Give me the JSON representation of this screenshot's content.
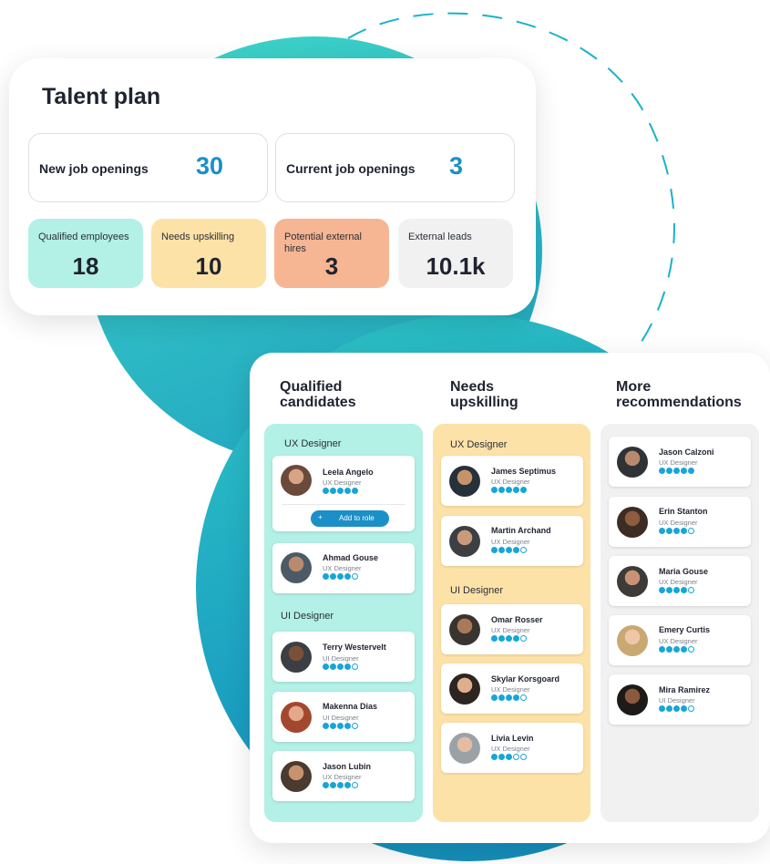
{
  "colors": {
    "accent": "#1b8fc7",
    "teal": "#b3f0e6",
    "yellow": "#fde2a8",
    "orange": "#f6b593",
    "gray": "#f1f1f2"
  },
  "talent_plan": {
    "title": "Talent plan",
    "openings": [
      {
        "label": "New job openings",
        "value": "30"
      },
      {
        "label": "Current job openings",
        "value": "3"
      }
    ],
    "stats": [
      {
        "label": "Qualified employees",
        "value": "18"
      },
      {
        "label": "Needs upskilling",
        "value": "10"
      },
      {
        "label": "Potential external hires",
        "value": "3"
      },
      {
        "label": "External leads",
        "value": "10.1k"
      }
    ]
  },
  "board": {
    "columns": [
      {
        "title": "Qualified candidates"
      },
      {
        "title": "Needs upskilling"
      },
      {
        "title": "More recommendations"
      }
    ],
    "qualified": {
      "group_ux": "UX Designer",
      "group_ui": "UI Designer",
      "add_button": "Add to role",
      "people": [
        {
          "name": "Leela Angelo",
          "role": "UX Designer",
          "rating": 5
        },
        {
          "name": "Ahmad Gouse",
          "role": "UX Designer",
          "rating": 4
        },
        {
          "name": "Terry Westervelt",
          "role": "UI Designer",
          "rating": 4
        },
        {
          "name": "Makenna Dias",
          "role": "UI Designer",
          "rating": 4
        },
        {
          "name": "Jason Lubin",
          "role": "UX Designer",
          "rating": 4
        }
      ]
    },
    "upskilling": {
      "group_ux": "UX Designer",
      "group_ui": "UI Designer",
      "people": [
        {
          "name": "James Septimus",
          "role": "UX Designer",
          "rating": 5
        },
        {
          "name": "Martin Archand",
          "role": "UX Designer",
          "rating": 4
        },
        {
          "name": "Omar Rosser",
          "role": "UX Designer",
          "rating": 4
        },
        {
          "name": "Skylar Korsgoard",
          "role": "UX Designer",
          "rating": 4
        },
        {
          "name": "Livia Levin",
          "role": "UX Designer",
          "rating": 3
        }
      ]
    },
    "recommendations": {
      "people": [
        {
          "name": "Jason Calzoni",
          "role": "UX Designer",
          "rating": 5
        },
        {
          "name": "Erin Stanton",
          "role": "UX Designer",
          "rating": 4
        },
        {
          "name": "Maria Gouse",
          "role": "UX Designer",
          "rating": 4
        },
        {
          "name": "Emery Curtis",
          "role": "UX Designer",
          "rating": 4
        },
        {
          "name": "Mira Ramirez",
          "role": "UI Designer",
          "rating": 4
        }
      ]
    }
  }
}
